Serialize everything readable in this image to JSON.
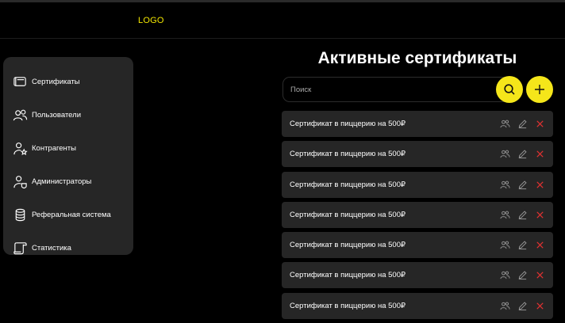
{
  "header": {
    "logo": "LOGO"
  },
  "sidebar": {
    "items": [
      {
        "label": "Сертификаты",
        "icon": "certificate-icon"
      },
      {
        "label": "Пользователи",
        "icon": "users-icon"
      },
      {
        "label": "Контрагенты",
        "icon": "contractor-star-icon"
      },
      {
        "label": "Администраторы",
        "icon": "admin-icon"
      },
      {
        "label": "Реферальная система",
        "icon": "database-icon"
      },
      {
        "label": "Статистика",
        "icon": "scroll-icon"
      }
    ]
  },
  "main": {
    "title": "Активные сертификаты",
    "search_placeholder": "Поиск",
    "certificates": [
      {
        "title": "Сертификат в пиццерию на 500₽"
      },
      {
        "title": "Сертификат в пиццерию на 500₽"
      },
      {
        "title": "Сертификат в пиццерию на 500₽"
      },
      {
        "title": "Сертификат в пиццерию на 500₽"
      },
      {
        "title": "Сертификат в пиццерию на 500₽"
      },
      {
        "title": "Сертификат в пиццерию на 500₽"
      },
      {
        "title": "Сертификат в пиццерию на 500₽"
      }
    ]
  },
  "colors": {
    "accent": "#f5e61a",
    "logo": "#f2e600",
    "panel": "#262626",
    "delete": "#e03131",
    "icon_muted": "#9a9a9a"
  }
}
